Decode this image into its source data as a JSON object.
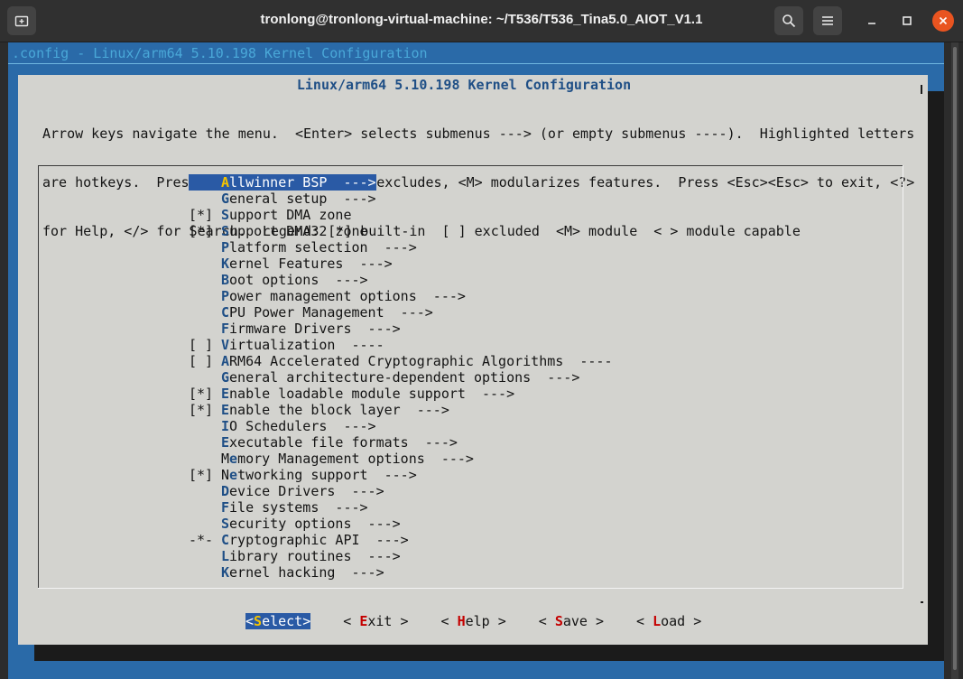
{
  "window": {
    "title": "tronlong@tronlong-virtual-machine: ~/T536/T536_Tina5.0_AIOT_V1.1",
    "icons": [
      "new-tab-icon",
      "search-icon",
      "hamburger-menu-icon",
      "minimize-icon",
      "maximize-icon",
      "close-icon"
    ]
  },
  "terminal": {
    "header": ".config - Linux/arm64 5.10.198 Kernel Configuration",
    "dialog_title": "Linux/arm64 5.10.198 Kernel Configuration",
    "help_lines": [
      "Arrow keys navigate the menu.  <Enter> selects submenus ---> (or empty submenus ----).  Highlighted letters",
      "are hotkeys.  Pressing <Y> includes, <N> excludes, <M> modularizes features.  Press <Esc><Esc> to exit, <?>",
      "for Help, </> for Search.  Legend: [*] built-in  [ ] excluded  <M> module  < > module capable"
    ],
    "menu_items": [
      {
        "mark": "",
        "hotkey": "A",
        "rest": "llwinner BSP  --->",
        "selected": true
      },
      {
        "mark": "",
        "hotkey": "G",
        "rest": "eneral setup  --->"
      },
      {
        "mark": "[*]",
        "hotkey": "S",
        "rest": "upport DMA zone"
      },
      {
        "mark": "[*]",
        "hotkey": "S",
        "rest": "upport DMA32 zone"
      },
      {
        "mark": "",
        "hotkey": "P",
        "rest": "latform selection  --->"
      },
      {
        "mark": "",
        "hotkey": "K",
        "rest": "ernel Features  --->"
      },
      {
        "mark": "",
        "hotkey": "B",
        "rest": "oot options  --->"
      },
      {
        "mark": "",
        "hotkey": "P",
        "rest": "ower management options  --->"
      },
      {
        "mark": "",
        "hotkey": "C",
        "rest": "PU Power Management  --->"
      },
      {
        "mark": "",
        "hotkey": "F",
        "rest": "irmware Drivers  --->"
      },
      {
        "mark": "[ ]",
        "hotkey": "V",
        "rest": "irtualization  ----"
      },
      {
        "mark": "[ ]",
        "hotkey": "A",
        "rest": "RM64 Accelerated Cryptographic Algorithms  ----"
      },
      {
        "mark": "",
        "hotkey": "G",
        "rest": "eneral architecture-dependent options  --->"
      },
      {
        "mark": "[*]",
        "hotkey": "E",
        "rest": "nable loadable module support  --->"
      },
      {
        "mark": "[*]",
        "hotkey": "E",
        "rest": "nable the block layer  --->"
      },
      {
        "mark": "",
        "hotkey": "I",
        "rest": "O Schedulers  --->"
      },
      {
        "mark": "",
        "hotkey": "E",
        "rest": "xecutable file formats  --->"
      },
      {
        "mark": "",
        "pre": "M",
        "hotkey": "e",
        "rest": "mory Management options  --->"
      },
      {
        "mark": "[*]",
        "pre": "N",
        "hotkey": "e",
        "rest": "tworking support  --->"
      },
      {
        "mark": "",
        "hotkey": "D",
        "rest": "evice Drivers  --->"
      },
      {
        "mark": "",
        "hotkey": "F",
        "rest": "ile systems  --->"
      },
      {
        "mark": "",
        "hotkey": "S",
        "rest": "ecurity options  --->"
      },
      {
        "mark": "-*-",
        "hotkey": "C",
        "rest": "ryptographic API  --->"
      },
      {
        "mark": "",
        "hotkey": "L",
        "rest": "ibrary routines  --->"
      },
      {
        "mark": "",
        "hotkey": "K",
        "rest": "ernel hacking  --->"
      }
    ],
    "buttons": [
      {
        "pre": "<",
        "hotkey": "S",
        "rest": "elect>",
        "active": true
      },
      {
        "pre": "< ",
        "hotkey": "E",
        "rest": "xit >",
        "active": false
      },
      {
        "pre": "< ",
        "hotkey": "H",
        "rest": "elp >",
        "active": false
      },
      {
        "pre": "< ",
        "hotkey": "S",
        "rest": "ave >",
        "active": false
      },
      {
        "pre": "< ",
        "hotkey": "L",
        "rest": "oad >",
        "active": false
      }
    ]
  }
}
